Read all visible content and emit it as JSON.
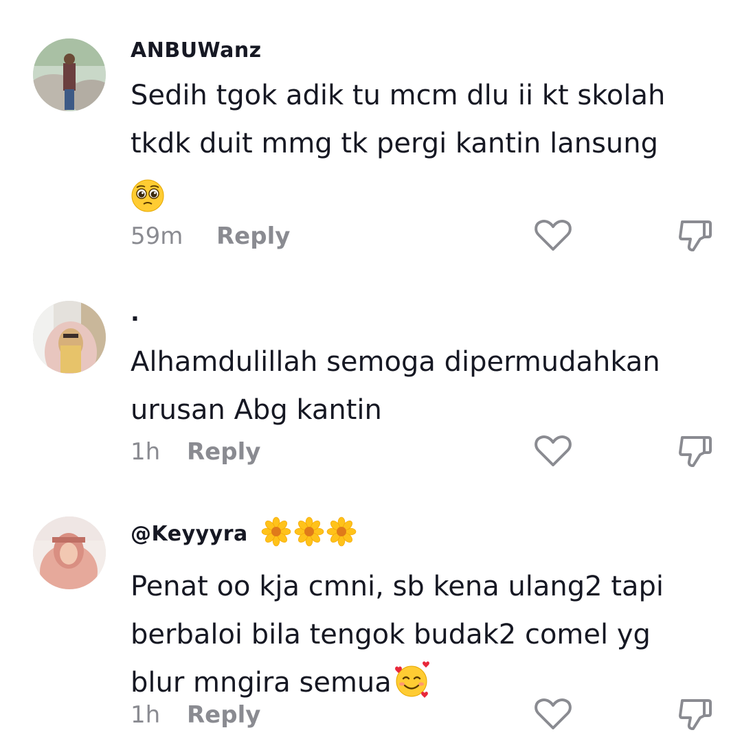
{
  "comments": [
    {
      "username": "ANBUWanz",
      "text_line1": "Sedih tgok adik tu mcm dlu ii kt skolah",
      "text_line2": "tkdk duit mmg tk pergi kantin lansung",
      "emoji": "pleading-face",
      "time": "59m",
      "reply_label": "Reply"
    },
    {
      "username": ".",
      "text_line1": "Alhamdulillah semoga dipermudahkan",
      "text_line2": "urusan Abg kantin",
      "time": "1h",
      "reply_label": "Reply"
    },
    {
      "username": "@Keyyyra",
      "badge_emoji": "sunflower x3",
      "text_line1": "Penat oo kja cmni, sb kena ulang2 tapi",
      "text_line2": "berbaloi bila tengok budak2 comel yg",
      "text_line3": "blur mngira semua",
      "emoji": "smiling-face-with-hearts",
      "time": "1h",
      "reply_label": "Reply"
    }
  ],
  "colors": {
    "text": "#161823",
    "muted": "#8a8b91",
    "background": "#ffffff"
  },
  "icons": {
    "like": "heart-outline-icon",
    "dislike": "thumbs-down-outline-icon"
  }
}
